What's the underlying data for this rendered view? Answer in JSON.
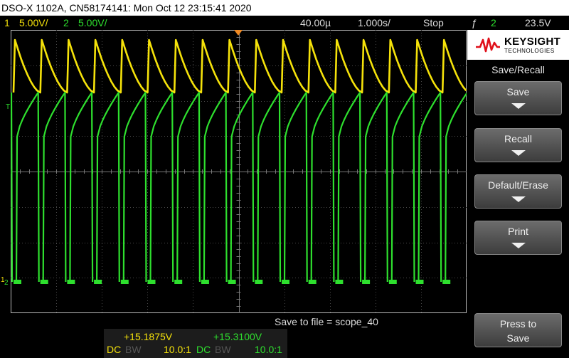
{
  "title": "DSO-X 1102A, CN58174141: Mon Oct 12 23:15:41 2020",
  "status": {
    "ch1_num": "1",
    "ch1_scale": "5.00V/",
    "ch2_num": "2",
    "ch2_scale": "5.00V/",
    "delay": "40.00µ",
    "timebase": "1.000s/",
    "run_state": "Stop",
    "trigger_icon": "ƒ",
    "trigger_source": "2",
    "trigger_level": "23.5V"
  },
  "left_markers": {
    "trigger": "T",
    "ch1": "1",
    "ch2": "2"
  },
  "colors": {
    "ch1": "#f5e20a",
    "ch2": "#2ee02e",
    "trigger_marker": "#f08a24",
    "grid": "#4a4a4a"
  },
  "message": "Save to file =  scope_40",
  "measurements": {
    "ch1_value": "+15.1875V",
    "ch2_value": "+15.3100V",
    "ch1_coupling": "DC",
    "ch1_bw": "BW",
    "ch1_probe": "10.0:1",
    "ch2_coupling": "DC",
    "ch2_bw": "BW",
    "ch2_probe": "10.0:1"
  },
  "side_panel": {
    "brand": "KEYSIGHT",
    "brand_sub": "TECHNOLOGIES",
    "menu_title": "Save/Recall",
    "keys": [
      {
        "label": "Save"
      },
      {
        "label": "Recall"
      },
      {
        "label": "Default/Erase"
      },
      {
        "label": "Print"
      }
    ],
    "press_to": "Press to",
    "press_action": "Save"
  }
}
